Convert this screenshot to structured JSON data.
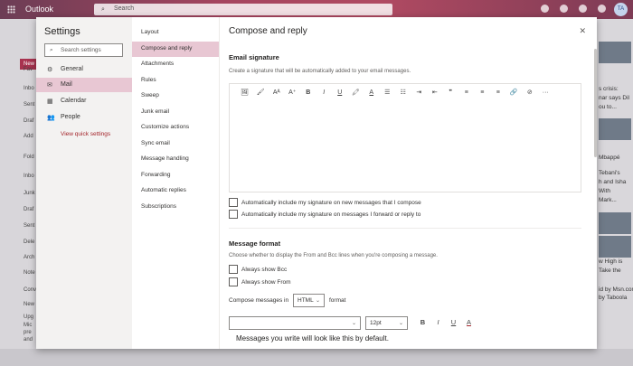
{
  "app": {
    "name": "Outlook",
    "search_placeholder": "Search",
    "avatar_initials": "TA"
  },
  "background": {
    "left_items": [
      "New",
      "Fav",
      "Inbo",
      "Sent",
      "Draf",
      "Add",
      "Fold",
      "Inbo",
      "Junk",
      "Draf",
      "Sent",
      "Dele",
      "Arch",
      "Note",
      "Conv",
      "New",
      "Upg",
      "Mic",
      "pre",
      "and"
    ],
    "right_texts": [
      "s crisis:",
      "nar says Dil",
      "ou to...",
      "Mbappé",
      "Tebani's",
      "h and Isha",
      "With",
      "Mark...",
      "w High is",
      "Take the",
      "id by Msn.com",
      "by Taboola"
    ]
  },
  "settings": {
    "title": "Settings",
    "search_placeholder": "Search settings",
    "categories": [
      {
        "label": "General",
        "icon": "gear-icon",
        "glyph": "⚙"
      },
      {
        "label": "Mail",
        "icon": "mail-icon",
        "glyph": "✉"
      },
      {
        "label": "Calendar",
        "icon": "calendar-icon",
        "glyph": "▦"
      },
      {
        "label": "People",
        "icon": "people-icon",
        "glyph": "👥"
      }
    ],
    "active_category": "Mail",
    "quick_settings": "View quick settings"
  },
  "mail_nav": {
    "items": [
      "Layout",
      "Compose and reply",
      "Attachments",
      "Rules",
      "Sweep",
      "Junk email",
      "Customize actions",
      "Sync email",
      "Message handling",
      "Forwarding",
      "Automatic replies",
      "Subscriptions"
    ],
    "active": "Compose and reply"
  },
  "panel": {
    "title": "Compose and reply",
    "email_signature": {
      "heading": "Email signature",
      "description": "Create a signature that will be automatically added to your email messages.",
      "toolbar": [
        "🖼",
        "🖌",
        "Aᴬ",
        "A⁺",
        "B",
        "I",
        "U",
        "🖍",
        "A",
        "☰",
        "☷",
        "⇥",
        "⇤",
        "❞",
        "≡",
        "≡",
        "≡",
        "🔗",
        "⊘",
        "···"
      ],
      "checkboxes": [
        "Automatically include my signature on new messages that I compose",
        "Automatically include my signature on messages I forward or reply to"
      ]
    },
    "message_format": {
      "heading": "Message format",
      "description": "Choose whether to display the From and Bcc lines when you're composing a message.",
      "checkboxes": [
        "Always show Bcc",
        "Always show From"
      ],
      "compose_label": "Compose messages in",
      "compose_value": "HTML",
      "format_label": "format",
      "font_value": "",
      "size_value": "12pt",
      "format_buttons": [
        "B",
        "I",
        "U",
        "A"
      ],
      "preview_text": "Messages you write will look like this by default."
    }
  },
  "colors": {
    "accent": "#a4262c",
    "active_bg": "#e8c7d3"
  }
}
